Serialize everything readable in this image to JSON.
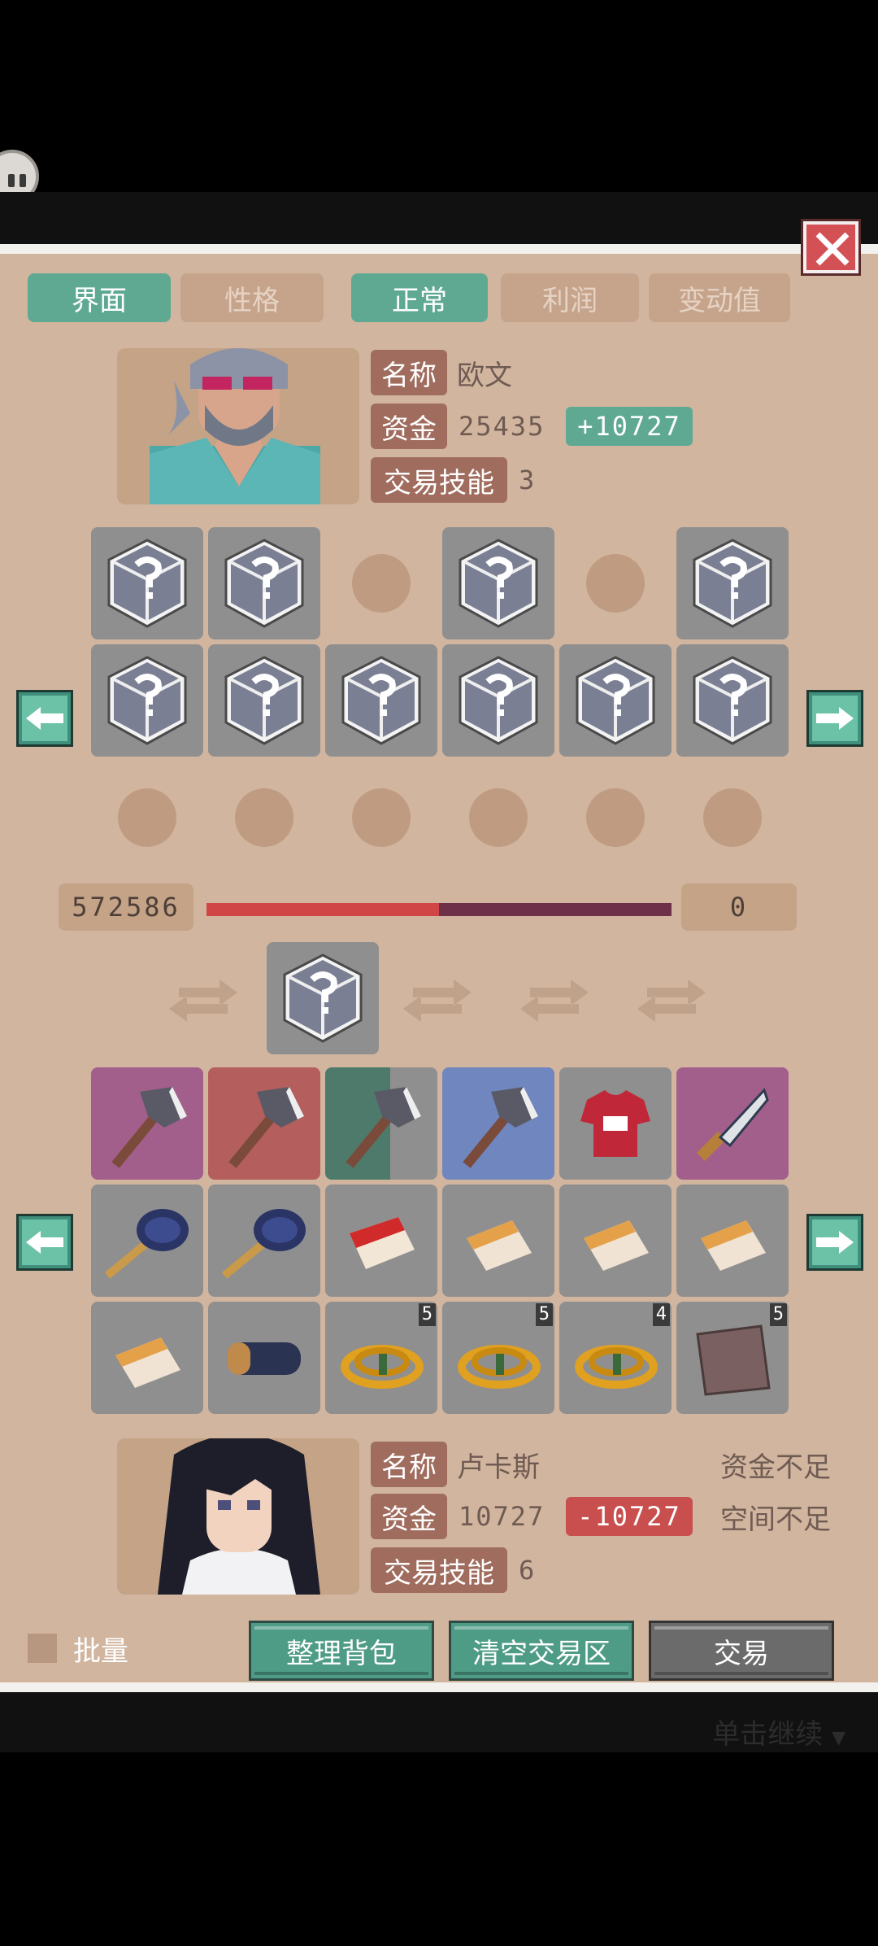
{
  "tabs": {
    "left": [
      {
        "label": "界面",
        "active": true
      },
      {
        "label": "性格",
        "active": false
      }
    ],
    "right": [
      {
        "label": "正常",
        "active": true
      },
      {
        "label": "利润",
        "active": false
      },
      {
        "label": "变动值",
        "active": false
      }
    ]
  },
  "trader": {
    "name_label": "名称",
    "name": "欧文",
    "funds_label": "资金",
    "funds": "25435",
    "funds_delta": "+10727",
    "skill_label": "交易技能",
    "skill": "3"
  },
  "trade_bar": {
    "left_value": "572586",
    "right_value": "0",
    "fill_fraction": 0.5
  },
  "player": {
    "name_label": "名称",
    "name": "卢卡斯",
    "funds_label": "资金",
    "funds": "10727",
    "funds_delta": "-10727",
    "skill_label": "交易技能",
    "skill": "6",
    "warning_funds": "资金不足",
    "warning_space": "空间不足"
  },
  "inventory_counts": {
    "rope1": "5",
    "rope2": "5",
    "rope3": "4",
    "cloth": "5"
  },
  "controls": {
    "batch_label": "批量",
    "sort_button": "整理背包",
    "clear_button": "清空交易区",
    "trade_button": "交易"
  },
  "footer": {
    "continue_text": "单击继续"
  },
  "colors": {
    "panel": "#d1b59f",
    "accent_green": "#5fa993",
    "label_brown": "#a06c5e",
    "delta_positive": "#5fa993",
    "delta_negative": "#c94f4f",
    "bar_red": "#d04646",
    "bar_dark": "#6e2f48"
  }
}
